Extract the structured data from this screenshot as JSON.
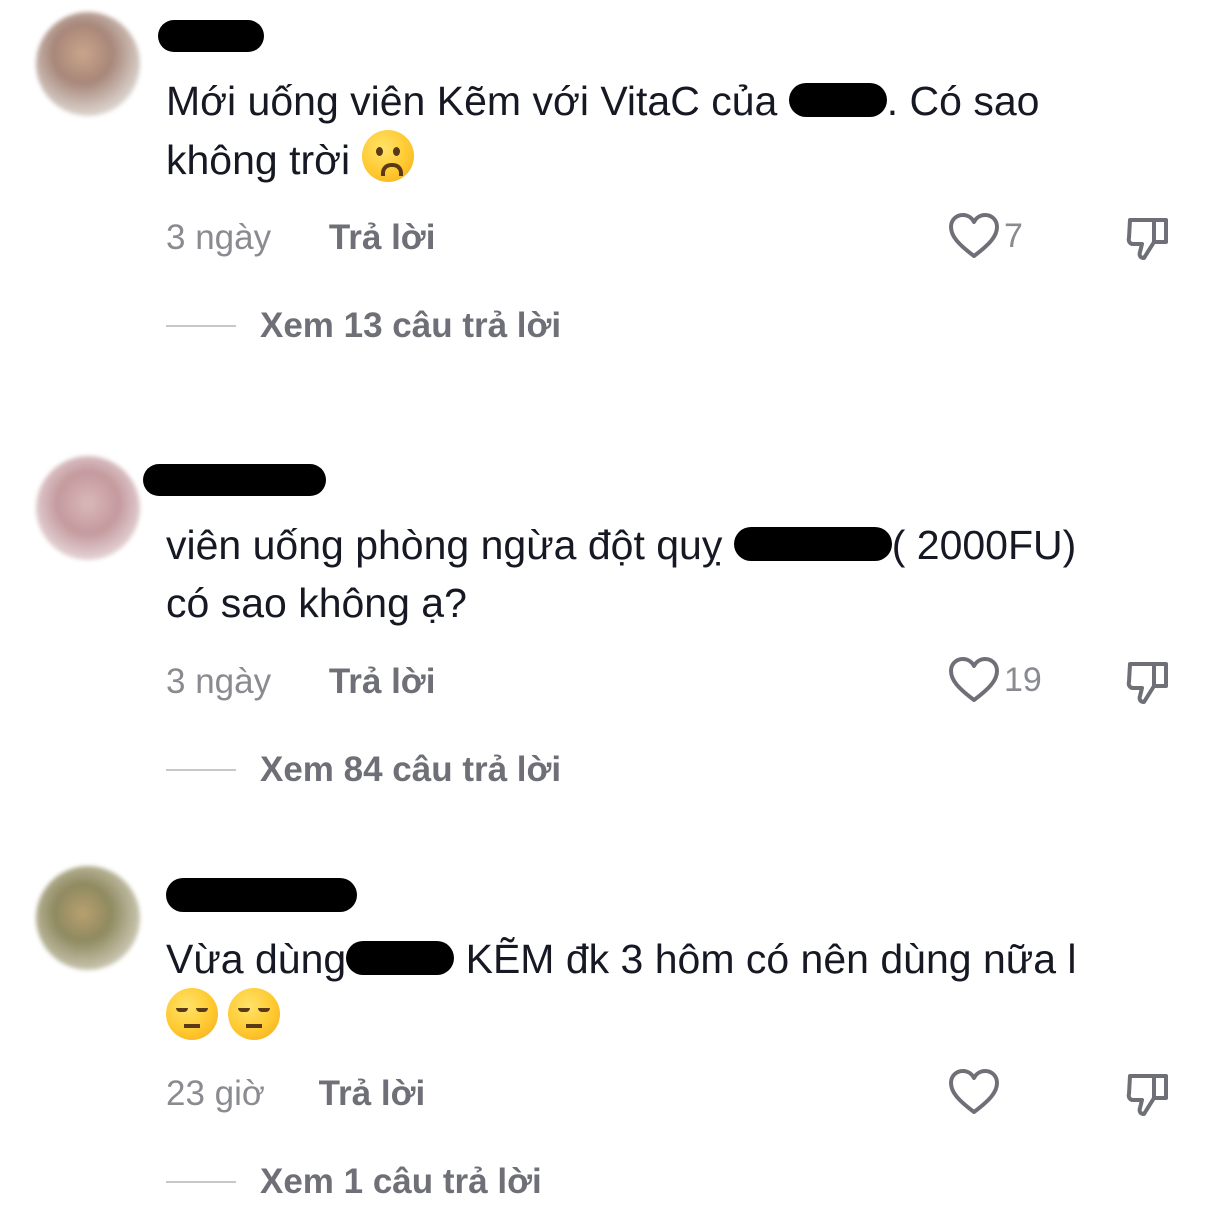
{
  "comments": [
    {
      "text_before": "Mới uống viên Kẽm với VitaC của ",
      "text_after": ". Có sao",
      "text_line2": "không trời",
      "emoji": "anxious-face",
      "time": "3 ngày",
      "reply_label": "Trả lời",
      "likes": "7",
      "view_replies": "Xem 13 câu trả lời"
    },
    {
      "text_before": "viên uống phòng ngừa đột quỵ ",
      "text_after": "( 2000FU)",
      "text_line2": "có sao không ạ?",
      "time": "3 ngày",
      "reply_label": "Trả lời",
      "likes": "19",
      "view_replies": "Xem 84 câu trả lời"
    },
    {
      "text_before": "Vừa dùng",
      "text_after": " KẼM đk 3 hôm có nên dùng nữa l",
      "emoji": "unamused-face",
      "time": "23 giờ",
      "reply_label": "Trả lời",
      "likes": "",
      "view_replies": "Xem 1 câu trả lời"
    }
  ],
  "colors": {
    "text": "#161823",
    "muted": "#8a8b91",
    "bold_muted": "#6f7077",
    "redaction": "#000000"
  }
}
